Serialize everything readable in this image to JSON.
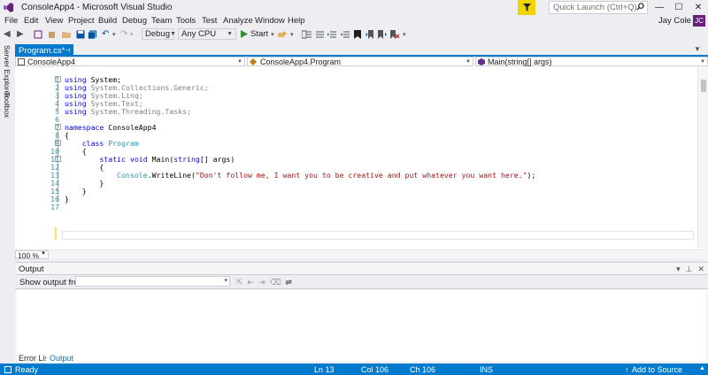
{
  "window": {
    "title": "ConsoleApp4 - Microsoft Visual Studio",
    "quick_launch_placeholder": "Quick Launch (Ctrl+Q)",
    "user_name": "Jay Cole",
    "avatar_initials": "JC"
  },
  "menu": [
    "File",
    "Edit",
    "View",
    "Project",
    "Build",
    "Debug",
    "Team",
    "Tools",
    "Test",
    "Analyze",
    "Window",
    "Help"
  ],
  "toolbar": {
    "configuration": "Debug",
    "platform": "Any CPU",
    "start_label": "Start"
  },
  "left_strip": {
    "server_explorer": "Server Explorer",
    "toolbox": "Toolbox"
  },
  "document_tab": {
    "label": "Program.cs*"
  },
  "nav_bar": {
    "project": "ConsoleApp4",
    "type": "ConsoleApp4.Program",
    "member": "Main(string[] args)"
  },
  "code_lines": [
    "using System;",
    "using System.Collections.Generic;",
    "using System.Linq;",
    "using System.Text;",
    "using System.Threading.Tasks;",
    "",
    "namespace ConsoleApp4",
    "{",
    "    class Program",
    "    {",
    "        static void Main(string[] args)",
    "        {",
    "            Console.WriteLine(\"Don't follow me, I want you to be creative and put whatever you want here.\");",
    "        }",
    "    }",
    "}",
    ""
  ],
  "line_numbers": [
    "1",
    "2",
    "3",
    "4",
    "5",
    "6",
    "7",
    "8",
    "9",
    "10",
    "11",
    "12",
    "13",
    "14",
    "15",
    "16",
    "17"
  ],
  "editor": {
    "zoom": "100 %",
    "current_line": 13
  },
  "output_panel": {
    "title": "Output",
    "show_from_label": "Show output from:"
  },
  "bottom_tabs": [
    "Error List",
    "Output"
  ],
  "status": {
    "ready": "Ready",
    "ln": "Ln 13",
    "col": "Col 106",
    "ch": "Ch 106",
    "mode": "INS",
    "source_control": "Add to Source Control"
  },
  "colors": {
    "accent": "#007acc",
    "avatar": "#68217a",
    "notify": "#f0d400",
    "keyword": "#0000ff",
    "type": "#2b91af",
    "string": "#a31515"
  }
}
